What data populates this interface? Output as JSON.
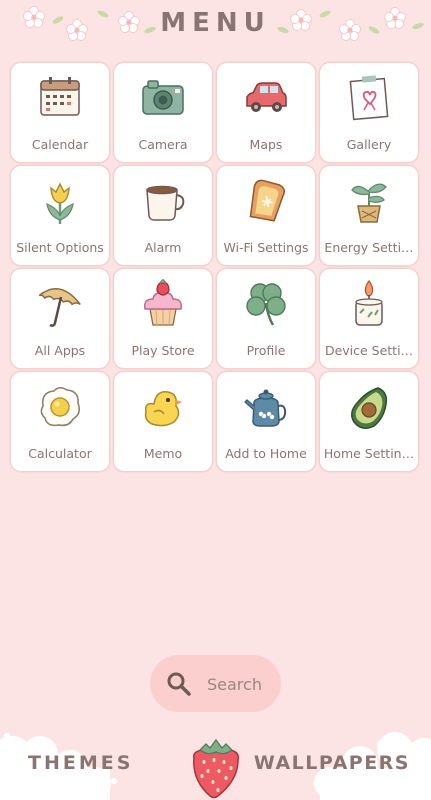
{
  "header": {
    "title": "MENU"
  },
  "colors": {
    "background": "#fde4e4",
    "tile": "#ffffff",
    "tile_border": "#f6cfcf",
    "text": "#8b7572",
    "search_bg": "#fbcfcd"
  },
  "apps": [
    {
      "label": "Calendar",
      "icon": "calendar-icon"
    },
    {
      "label": "Camera",
      "icon": "camera-icon"
    },
    {
      "label": "Maps",
      "icon": "car-icon"
    },
    {
      "label": "Gallery",
      "icon": "picture-frame-icon"
    },
    {
      "label": "Silent Options",
      "icon": "tulip-icon"
    },
    {
      "label": "Alarm",
      "icon": "coffee-cup-icon"
    },
    {
      "label": "Wi-Fi Settings",
      "icon": "toast-icon"
    },
    {
      "label": "Energy Setti…",
      "icon": "potted-plant-icon"
    },
    {
      "label": "All Apps",
      "icon": "umbrella-icon"
    },
    {
      "label": "Play Store",
      "icon": "cupcake-icon"
    },
    {
      "label": "Profile",
      "icon": "clover-icon"
    },
    {
      "label": "Device Setti…",
      "icon": "candle-icon"
    },
    {
      "label": "Calculator",
      "icon": "fried-egg-icon"
    },
    {
      "label": "Memo",
      "icon": "chick-icon"
    },
    {
      "label": "Add to Home",
      "icon": "teapot-icon"
    },
    {
      "label": "Home Settin…",
      "icon": "avocado-icon"
    }
  ],
  "search": {
    "label": "Search",
    "icon": "search-icon"
  },
  "footer": {
    "themes_label": "THEMES",
    "wallpapers_label": "WALLPAPERS",
    "center_icon": "strawberry-icon"
  }
}
